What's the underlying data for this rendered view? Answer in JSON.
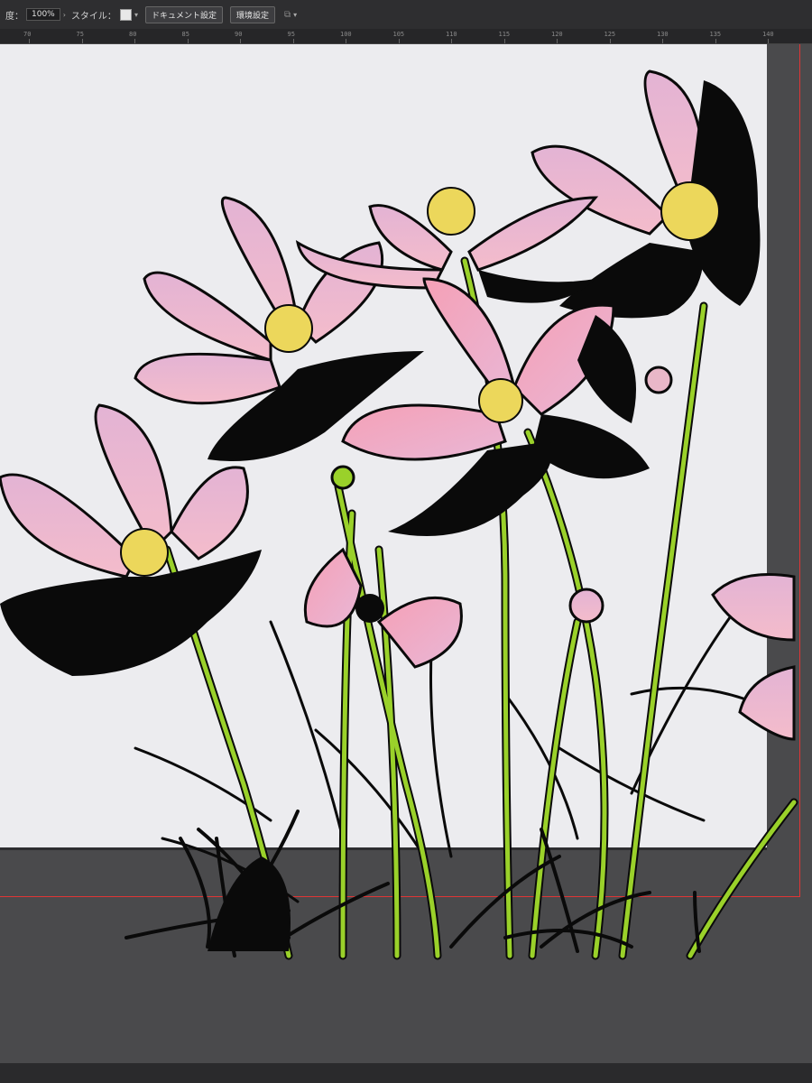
{
  "control_bar": {
    "opacity_label": "度：",
    "opacity_value": "100%",
    "style_label": "スタイル：",
    "document_settings": "ドキュメント設定",
    "preferences": "環境設定"
  },
  "ruler": {
    "labels": [
      "70",
      "75",
      "80",
      "85",
      "90",
      "95",
      "100",
      "105",
      "110",
      "115",
      "120",
      "125",
      "130",
      "135",
      "140"
    ]
  },
  "colors": {
    "petal_pink": "#e9b3cf",
    "petal_deep": "#f2a2b9",
    "shadow": "#0a0a0a",
    "stem_green": "#9ad12a",
    "center_yellow": "#ecd75b",
    "artboard": "#ececef",
    "pasteboard": "#4a4a4c",
    "bleed_guide": "#e03535"
  },
  "icons": [
    "chevron-right-icon",
    "chevron-down-icon",
    "arrange-icon"
  ]
}
